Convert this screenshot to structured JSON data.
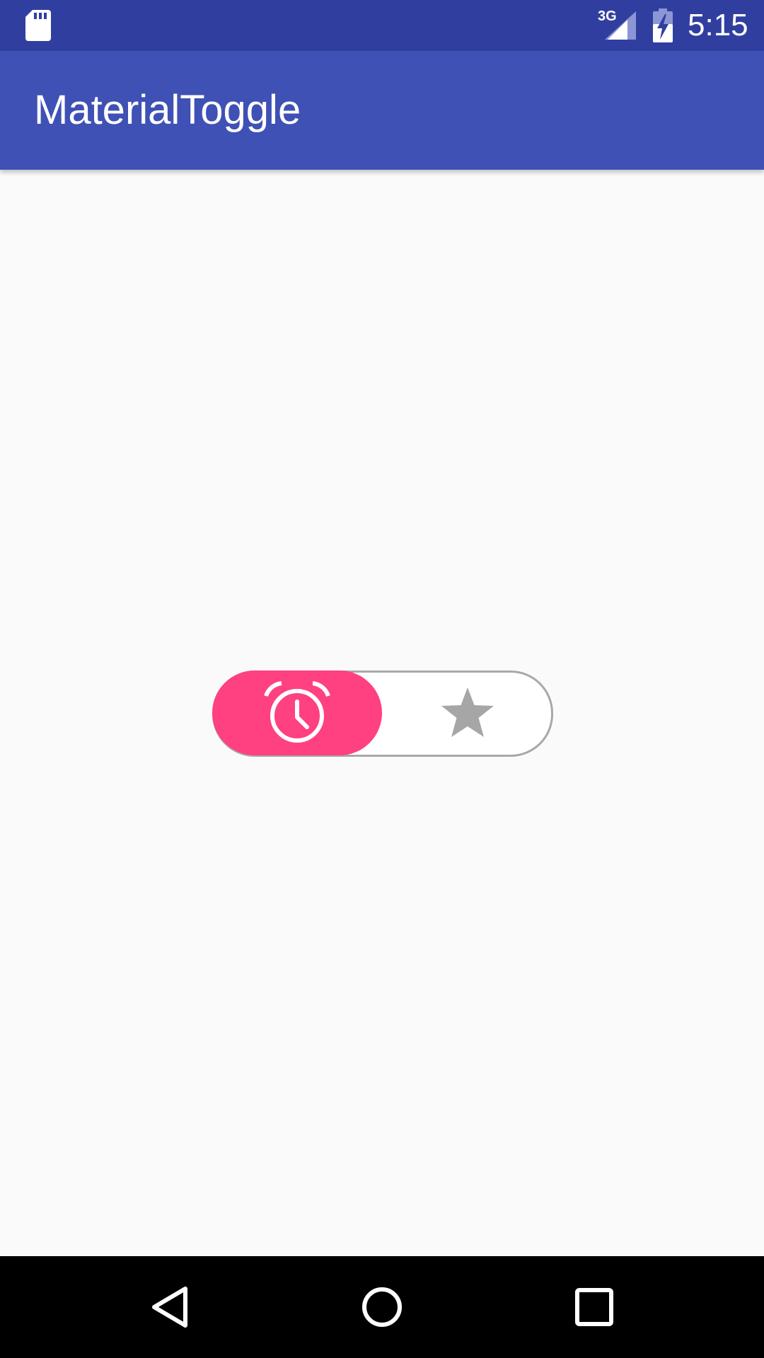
{
  "status_bar": {
    "network": "3G",
    "time": "5:15",
    "icons": [
      "sd-card-icon",
      "signal-icon",
      "battery-charging-icon"
    ]
  },
  "app_bar": {
    "title": "MaterialToggle"
  },
  "toggle": {
    "selected": "alarm",
    "options": [
      "alarm-icon",
      "star-icon"
    ],
    "colors": {
      "accent": "#ff4081",
      "track_border": "#a8a8a8",
      "inactive_icon": "#a6a6a6"
    }
  },
  "navigation": {
    "buttons": [
      "back-icon",
      "home-icon",
      "recents-icon"
    ]
  },
  "colors": {
    "status_bar": "#303f9f",
    "app_bar": "#3f51b5",
    "background": "#fafafa"
  }
}
